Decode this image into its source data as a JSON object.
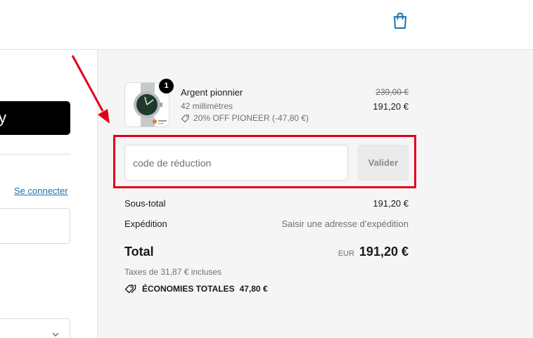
{
  "header": {
    "cart_icon": "shopping-bag-icon",
    "accent_color": "#1773b0"
  },
  "left": {
    "express_button_label": "y",
    "login_link": "Se connecter",
    "select_chevron_icon": "chevron-down-icon"
  },
  "order": {
    "item": {
      "quantity": "1",
      "name": "Argent pionnier",
      "size": "42 millimètres",
      "discount_label": "20% OFF PIONEER (-47,80 €)",
      "discount_icon": "tag-icon",
      "original_price": "239,00 €",
      "price": "191,20 €",
      "thumbnail_icon": "watch-image"
    },
    "discount_code": {
      "placeholder": "code de réduction",
      "value": "",
      "apply_label": "Valider"
    },
    "subtotal": {
      "label": "Sous-total",
      "value": "191,20 €"
    },
    "shipping": {
      "label": "Expédition",
      "value": "Saisir une adresse d’expédition"
    },
    "total": {
      "label": "Total",
      "currency": "EUR",
      "value": "191,20 €",
      "taxes_note": "Taxes de 31,87 € incluses"
    },
    "savings": {
      "icon": "tags-icon",
      "label": "ÉCONOMIES TOTALES",
      "value": "47,80 €"
    }
  },
  "annotation": {
    "highlight_color": "#e0001b"
  }
}
